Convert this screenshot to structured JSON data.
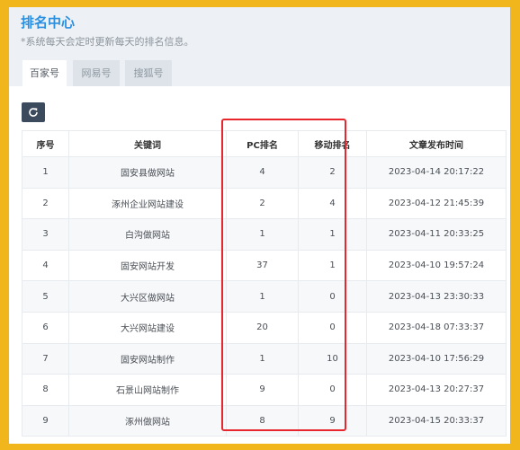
{
  "header": {
    "title": "排名中心",
    "subtitle": "*系统每天会定时更新每天的排名信息。"
  },
  "tabs": [
    {
      "label": "百家号",
      "active": true
    },
    {
      "label": "网易号",
      "active": false
    },
    {
      "label": "搜狐号",
      "active": false
    }
  ],
  "toolbar": {
    "refresh_icon": "refresh-icon"
  },
  "table": {
    "columns": [
      "序号",
      "关键词",
      "PC排名",
      "移动排名",
      "文章发布时间"
    ],
    "rows": [
      [
        "1",
        "固安县做网站",
        "4",
        "2",
        "2023-04-14 20:17:22"
      ],
      [
        "2",
        "涿州企业网站建设",
        "2",
        "4",
        "2023-04-12 21:45:39"
      ],
      [
        "3",
        "白沟做网站",
        "1",
        "1",
        "2023-04-11 20:33:25"
      ],
      [
        "4",
        "固安网站开发",
        "37",
        "1",
        "2023-04-10 19:57:24"
      ],
      [
        "5",
        "大兴区做网站",
        "1",
        "0",
        "2023-04-13 23:30:33"
      ],
      [
        "6",
        "大兴网站建设",
        "20",
        "0",
        "2023-04-18 07:33:37"
      ],
      [
        "7",
        "固安网站制作",
        "1",
        "10",
        "2023-04-10 17:56:29"
      ],
      [
        "8",
        "石景山网站制作",
        "9",
        "0",
        "2023-04-13 20:27:37"
      ],
      [
        "9",
        "涿州做网站",
        "8",
        "9",
        "2023-04-15 20:33:37"
      ]
    ]
  },
  "colors": {
    "frame_border": "#f0b61b",
    "title": "#2a8fe0",
    "highlight": "#e8262d",
    "button": "#3c4a5e"
  }
}
